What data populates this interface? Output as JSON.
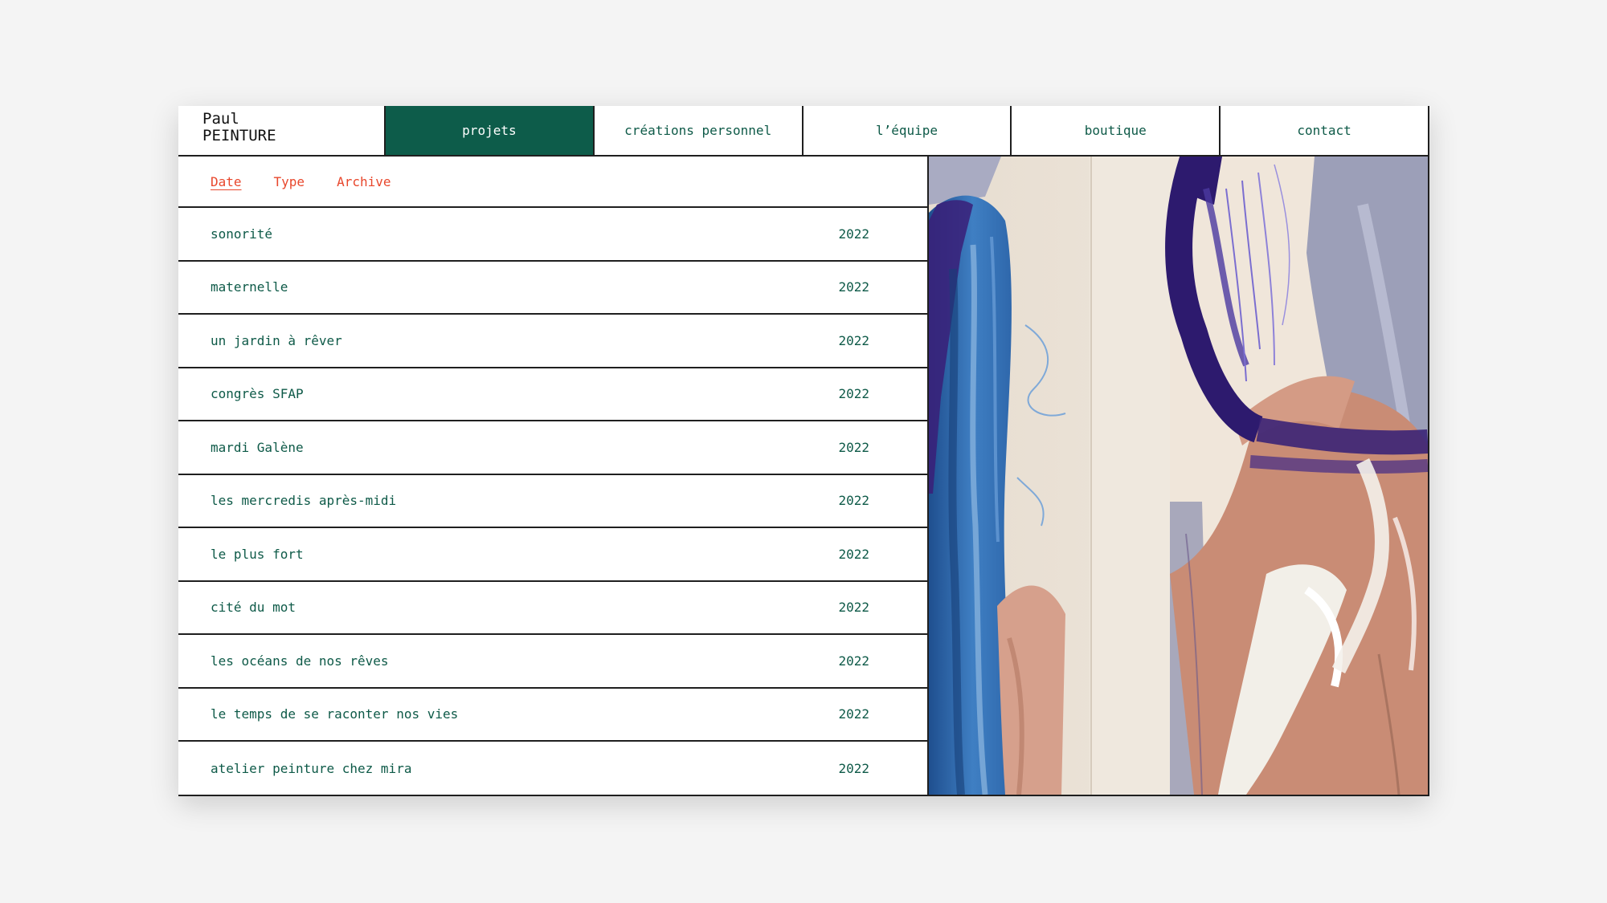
{
  "logo": {
    "line1": "Paul",
    "line2": "PEINTURE"
  },
  "nav": {
    "items": [
      {
        "label": "projets",
        "active": true
      },
      {
        "label": "créations personnel",
        "active": false
      },
      {
        "label": "l’équipe",
        "active": false
      },
      {
        "label": "boutique",
        "active": false
      },
      {
        "label": "contact",
        "active": false
      }
    ]
  },
  "filters": {
    "items": [
      {
        "label": "Date",
        "active": true
      },
      {
        "label": "Type",
        "active": false
      },
      {
        "label": "Archive",
        "active": false
      }
    ]
  },
  "projects": [
    {
      "title": "sonorité",
      "year": "2022"
    },
    {
      "title": "maternelle",
      "year": "2022"
    },
    {
      "title": "un jardin à rêver",
      "year": "2022"
    },
    {
      "title": "congrès SFAP",
      "year": "2022"
    },
    {
      "title": "mardi Galène",
      "year": "2022"
    },
    {
      "title": "les mercredis après-midi",
      "year": "2022"
    },
    {
      "title": "le plus fort",
      "year": "2022"
    },
    {
      "title": "cité du mot",
      "year": "2022"
    },
    {
      "title": "les océans de nos rêves",
      "year": "2022"
    },
    {
      "title": "le temps de se raconter nos vies",
      "year": "2022"
    },
    {
      "title": "atelier peinture chez mira",
      "year": "2022"
    }
  ],
  "colors": {
    "accent": "#0d5c4a",
    "text": "#0e5a48",
    "filter": "#e8472c",
    "border": "#1f1f1f",
    "background": "#f4f4f4"
  }
}
